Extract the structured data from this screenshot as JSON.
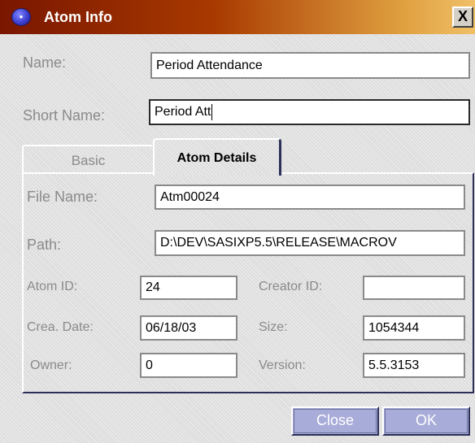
{
  "window": {
    "title": "Atom Info",
    "close_glyph": "X",
    "icon": "app-globe-icon"
  },
  "fields": {
    "name": {
      "label": "Name:",
      "value": "Period Attendance"
    },
    "short_name": {
      "label": "Short Name:",
      "value": "Period Att"
    }
  },
  "tabs": [
    {
      "label": "Basic",
      "selected": false
    },
    {
      "label": "Atom Details",
      "selected": true
    }
  ],
  "details": {
    "file_name": {
      "label": "File Name:",
      "value": "Atm00024"
    },
    "path": {
      "label": "Path:",
      "value": "D:\\DEV\\SASIXP5.5\\RELEASE\\MACROV"
    },
    "atom_id": {
      "label": "Atom ID:",
      "value": "24"
    },
    "creator_id": {
      "label": "Creator ID:",
      "value": ""
    },
    "crea_date": {
      "label": "Crea. Date:",
      "value": "06/18/03"
    },
    "size": {
      "label": "Size:",
      "value": "1054344"
    },
    "owner": {
      "label": "Owner:",
      "value": "0"
    },
    "version": {
      "label": "Version:",
      "value": "5.5.3153"
    }
  },
  "buttons": {
    "close": "Close",
    "ok": "OK"
  }
}
